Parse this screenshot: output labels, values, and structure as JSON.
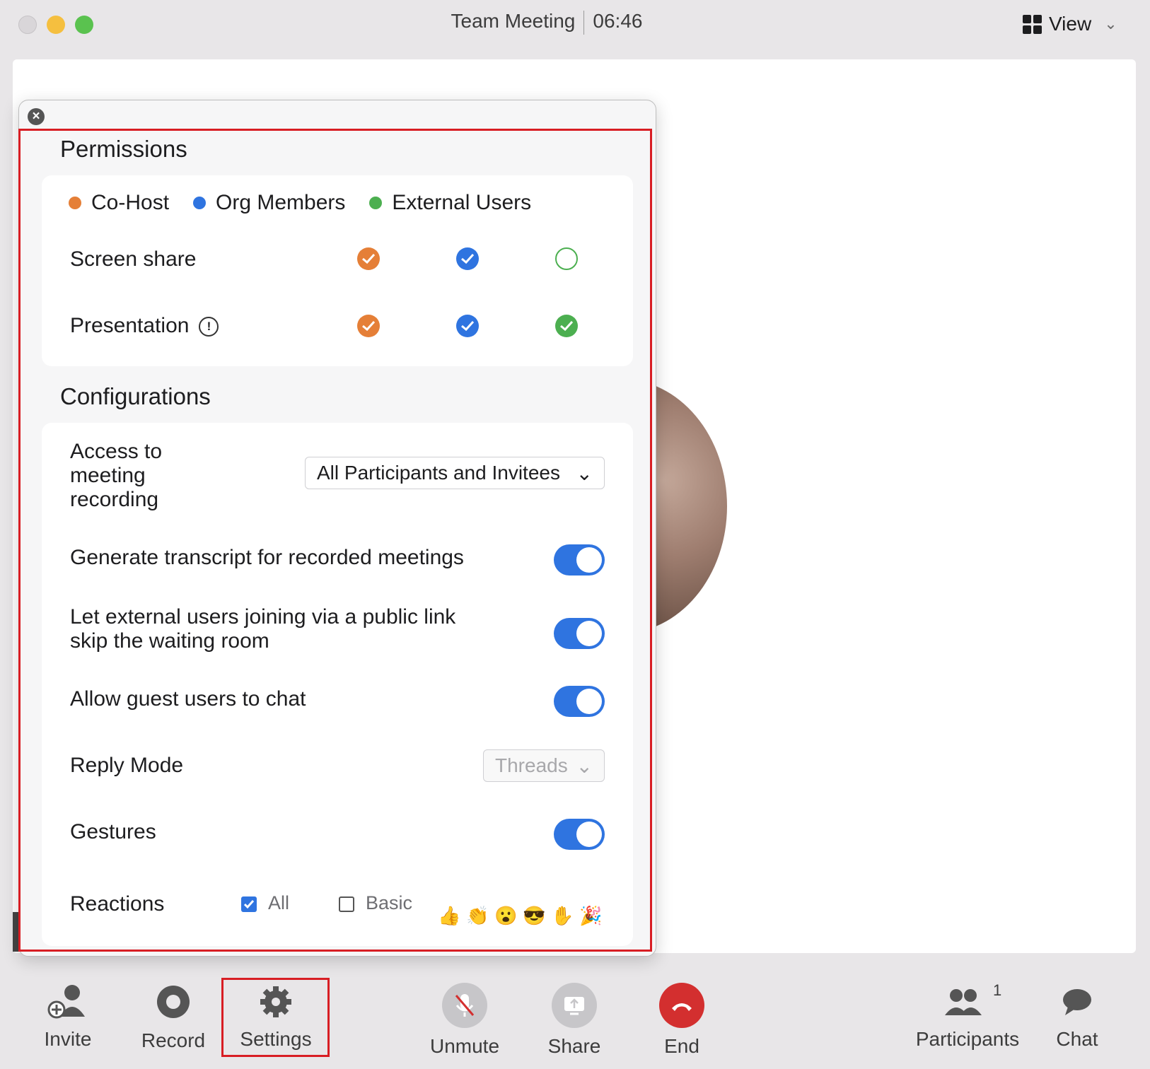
{
  "window": {
    "title": "Team Meeting",
    "timer": "06:46",
    "view_label": "View"
  },
  "panel": {
    "permissions": {
      "heading": "Permissions",
      "legend": [
        {
          "label": "Co-Host",
          "color": "#e57f37"
        },
        {
          "label": "Org Members",
          "color": "#2f74e0"
        },
        {
          "label": "External Users",
          "color": "#4caf50"
        }
      ],
      "rows": [
        {
          "label": "Screen share",
          "cohost": true,
          "org": true,
          "external": false
        },
        {
          "label": "Presentation",
          "cohost": true,
          "org": true,
          "external": true
        }
      ]
    },
    "configurations": {
      "heading": "Configurations",
      "recording_access_label": "Access to meeting recording",
      "recording_access_value": "All Participants and Invitees",
      "transcript_label": "Generate transcript for recorded meetings",
      "transcript_on": true,
      "skip_waiting_label": "Let external users joining via a public link skip the waiting room",
      "skip_waiting_on": true,
      "guest_chat_label": "Allow guest users to chat",
      "guest_chat_on": true,
      "reply_mode_label": "Reply Mode",
      "reply_mode_value": "Threads",
      "gestures_label": "Gestures",
      "gestures_on": true,
      "reactions_label": "Reactions",
      "reactions_all_label": "All",
      "reactions_all_checked": true,
      "reactions_basic_label": "Basic",
      "reactions_basic_checked": false,
      "reaction_emojis": [
        "👍",
        "👏",
        "😮",
        "😎",
        "✋",
        "🎉"
      ]
    }
  },
  "toolbar": {
    "invite": "Invite",
    "record": "Record",
    "settings": "Settings",
    "unmute": "Unmute",
    "share": "Share",
    "end": "End",
    "participants": "Participants",
    "participants_count": "1",
    "chat": "Chat"
  },
  "colors": {
    "accent": "#2f74e0",
    "end_red": "#d32f2f",
    "highlight": "#d81e24"
  }
}
